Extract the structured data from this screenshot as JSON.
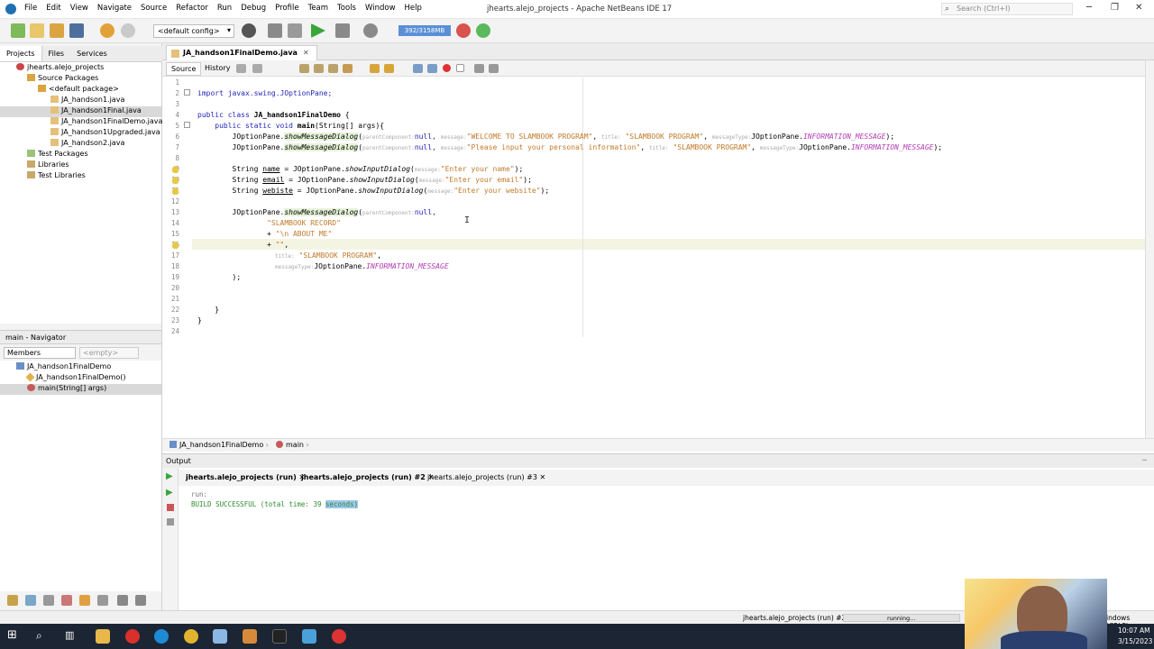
{
  "window": {
    "title": "jhearts.alejo_projects - Apache NetBeans IDE 17",
    "search_placeholder": "Search (Ctrl+I)",
    "menu": [
      "File",
      "Edit",
      "View",
      "Navigate",
      "Source",
      "Refactor",
      "Run",
      "Debug",
      "Profile",
      "Team",
      "Tools",
      "Window",
      "Help"
    ]
  },
  "toolbar": {
    "config": "<default config>",
    "memory": "392/3158MB"
  },
  "projects_panel": {
    "tabs": [
      "Projects",
      "Files",
      "Services"
    ],
    "tree": [
      {
        "label": "jhearts.alejo_projects"
      },
      {
        "label": "Source Packages"
      },
      {
        "label": "<default package>"
      },
      {
        "label": "JA_handson1.java"
      },
      {
        "label": "JA_handson1Final.java"
      },
      {
        "label": "JA_handson1FinalDemo.java"
      },
      {
        "label": "JA_handson1Upgraded.java"
      },
      {
        "label": "JA_handson2.java"
      },
      {
        "label": "Test Packages"
      },
      {
        "label": "Libraries"
      },
      {
        "label": "Test Libraries"
      }
    ]
  },
  "navigator": {
    "title": "main - Navigator",
    "members": "Members",
    "empty": "<empty>",
    "tree": [
      "JA_handson1FinalDemo",
      "JA_handson1FinalDemo()",
      "main(String[] args)"
    ]
  },
  "editor": {
    "tab": "JA_handson1FinalDemo.java",
    "subtabs": [
      "Source",
      "History"
    ],
    "line_numbers": [
      "1",
      "2",
      "3",
      "4",
      "5",
      "6",
      "7",
      "8",
      "9",
      "10",
      "11",
      "12",
      "13",
      "14",
      "15",
      "16",
      "17",
      "18",
      "19",
      "20",
      "21",
      "22",
      "23",
      "24"
    ],
    "lines": {
      "l2": "import javax.swing.JOptionPane;",
      "l4a": "public class ",
      "l4b": "JA_handson1FinalDemo",
      "l4c": " {",
      "l5a": "    public static void ",
      "l5b": "main",
      "l5c": "(String[] args){",
      "l6a": "        JOptionPane.",
      "l6b": "showMessageDialog",
      "l6c": "(",
      "l6h1": "parentComponent:",
      "l6d": "null, ",
      "l6h2": "message:",
      "l6e": "\"WELCOME TO SLAMBOOK PROGRAM\"",
      "l6f": ", ",
      "l6h3": "title:",
      "l6g": " \"SLAMBOOK PROGRAM\"",
      "l6i": ", ",
      "l6h4": "messageType:",
      "l6j": "JOptionPane.",
      "l6k": "INFORMATION_MESSAGE",
      "l6l": ");",
      "l7a": "        JOptionPane.",
      "l7b": "showMessageDialog",
      "l7c": "(",
      "l7h1": "parentComponent:",
      "l7d": "null, ",
      "l7h2": "message:",
      "l7e": "\"Please input your personal information\"",
      "l7f": ", ",
      "l7h3": "title:",
      "l7g": " \"SLAMBOOK PROGRAM\"",
      "l7i": ", ",
      "l7h4": "messageType:",
      "l7j": "JOptionPane.",
      "l7k": "INFORMATION_MESSAGE",
      "l7l": ");",
      "l9a": "        String ",
      "l9b": "name",
      "l9c": " = JOptionPane.",
      "l9d": "showInputDialog",
      "l9e": "(",
      "l9h": "message:",
      "l9f": "\"Enter your name\"",
      "l9g": ");",
      "l10a": "        String ",
      "l10b": "email",
      "l10c": " = JOptionPane.",
      "l10d": "showInputDialog",
      "l10e": "(",
      "l10h": "message:",
      "l10f": "\"Enter your email\"",
      "l10g": ");",
      "l11a": "        String ",
      "l11b": "webiste",
      "l11c": " = JOptionPane.",
      "l11d": "showInputDialog",
      "l11e": "(",
      "l11h": "message:",
      "l11f": "\"Enter your website\"",
      "l11g": ");",
      "l13a": "        JOptionPane.",
      "l13b": "showMessageDialog",
      "l13c": "(",
      "l13h": "parentComponent:",
      "l13d": "null,",
      "l14": "                \"SLAMBOOK RECORD\"",
      "l15a": "                + ",
      "l15b": "\"\\n ABOUT ME\"",
      "l16a": "                + ",
      "l16b": "\"\"",
      "l16c": ",",
      "l17h": "title:",
      "l17a": " \"SLAMBOOK PROGRAM\"",
      "l17b": ",",
      "l18h": "messageType:",
      "l18a": "JOptionPane.",
      "l18b": "INFORMATION_MESSAGE",
      "l19": "        );",
      "l22": "    }",
      "l23": "}"
    },
    "breadcrumb": [
      "JA_handson1FinalDemo",
      "main"
    ]
  },
  "output": {
    "title": "Output",
    "tabs": [
      "jhearts.alejo_projects (run)",
      "jhearts.alejo_projects (run) #2",
      "jhearts.alejo_projects (run) #3"
    ],
    "lines": [
      "run:",
      "BUILD SUCCESSFUL (total time: 39",
      "seconds)"
    ]
  },
  "status": {
    "task": "jhearts.alejo_projects (run) #2",
    "progress_label": "running...",
    "line_endings": "indows (CRLF)"
  },
  "taskbar": {
    "time": "10:07 AM",
    "date": "3/15/2023"
  }
}
